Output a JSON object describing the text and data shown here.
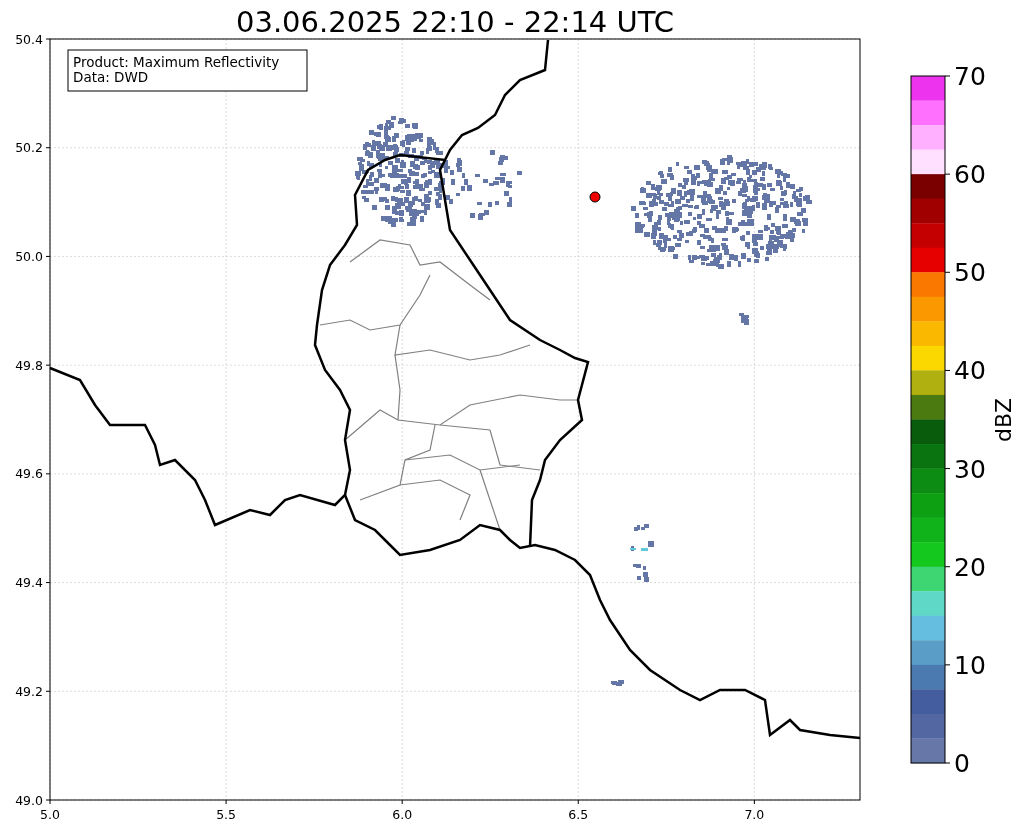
{
  "title": "03.06.2025 22:10 - 22:14 UTC",
  "legend_box": {
    "lines": [
      "Product: Maximum Reflectivity",
      "Data: DWD"
    ]
  },
  "axes": {
    "xticks": [
      "5.0",
      "5.5",
      "6.0",
      "6.5",
      "7.0"
    ],
    "yticks": [
      "50.4",
      "50.2",
      "50.0",
      "49.8",
      "49.6",
      "49.4",
      "49.2",
      "49.0"
    ]
  },
  "colorbar": {
    "label": "dBZ",
    "ticks": [
      "70",
      "60",
      "50",
      "40",
      "30",
      "20",
      "10",
      "0"
    ],
    "bands": [
      {
        "color": "#ee33ee"
      },
      {
        "color": "#ff70ff"
      },
      {
        "color": "#ffb0ff"
      },
      {
        "color": "#ffe0ff"
      },
      {
        "color": "#7a0000"
      },
      {
        "color": "#a00000"
      },
      {
        "color": "#c40000"
      },
      {
        "color": "#e60000"
      },
      {
        "color": "#fb7800"
      },
      {
        "color": "#fb9800"
      },
      {
        "color": "#fbb800"
      },
      {
        "color": "#fad800"
      },
      {
        "color": "#b0b010"
      },
      {
        "color": "#4a7a10"
      },
      {
        "color": "#085c0c"
      },
      {
        "color": "#0a7410"
      },
      {
        "color": "#0c8c12"
      },
      {
        "color": "#0ea013"
      },
      {
        "color": "#10b41a"
      },
      {
        "color": "#14c81e"
      },
      {
        "color": "#3dd672"
      },
      {
        "color": "#60d8c8"
      },
      {
        "color": "#65bde0"
      },
      {
        "color": "#5a9ec8"
      },
      {
        "color": "#4a7ab0"
      },
      {
        "color": "#435d9f"
      },
      {
        "color": "#5368a3"
      },
      {
        "color": "#6677a8"
      }
    ]
  }
}
